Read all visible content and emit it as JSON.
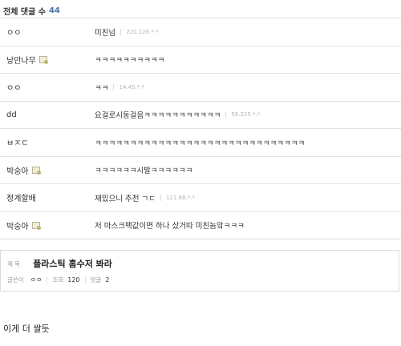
{
  "comments_header": {
    "label": "전체 댓글 수",
    "count": "44"
  },
  "comments": [
    {
      "nick": "ㅇㅇ",
      "member": false,
      "text": "미친넘",
      "ip": "220.126.*.*"
    },
    {
      "nick": "낭만나무",
      "member": true,
      "text": "ㅋㅋㅋㅋㅋㅋㅋㅋㅋㅋ",
      "ip": ""
    },
    {
      "nick": "ㅇㅇ",
      "member": false,
      "text": "ㅋㅋ",
      "ip": "14.45.*.*"
    },
    {
      "nick": "dd",
      "member": false,
      "text": "요걸로시동걸음ㅋㅋㅋㅋㅋㅋㅋㅋㅋㅋㅋ",
      "ip": "59.225.*.*"
    },
    {
      "nick": "ㅂㅈㄷ",
      "member": false,
      "text": "ㅋㅋㅋㅋㅋㅋㅋㅋㅋㅋㅋㅋㅋㅋㅋㅋㅋㅋㅋㅋㅋㅋㅋㅋㅋㅋㅋㅋㅋㅋ",
      "ip": ""
    },
    {
      "nick": "박숭아",
      "member": true,
      "text": "ㅋㅋㅋㅋㅋㅋ시발ㅋㅋㅋㅋㅋㅋ",
      "ip": ""
    },
    {
      "nick": "정계할배",
      "member": false,
      "text": "재밌으니 추천 ㄱㄷ",
      "ip": "121.88.*.*"
    },
    {
      "nick": "박숭아",
      "member": true,
      "text": "저 마스크팩값이면 하나 샀거따 미친놈앜ㅋㅋㅋ",
      "ip": ""
    }
  ],
  "post": {
    "title_label": "제 목",
    "title": "플라스틱 홈수저 봐라",
    "author_label": "글쓴이",
    "author": "ㅇㅇ",
    "views_label": "조회",
    "views": "120",
    "comments_label": "댓글",
    "comments": "2"
  },
  "body": {
    "text": "이게 더 쌀듯"
  }
}
